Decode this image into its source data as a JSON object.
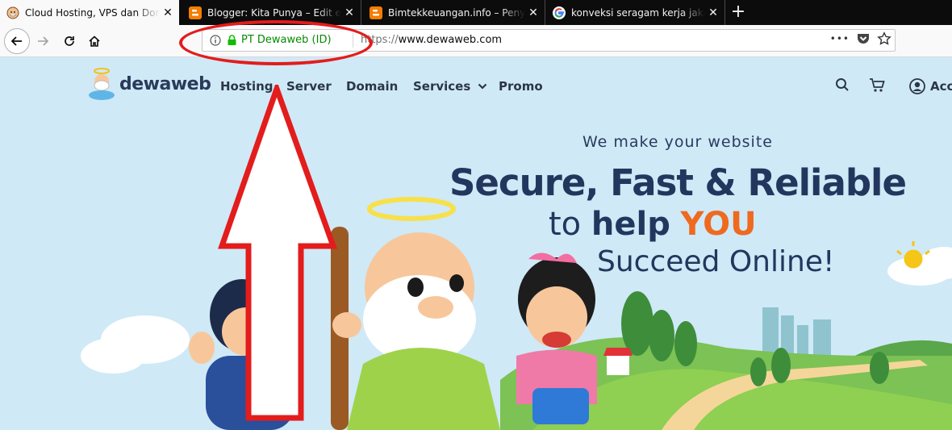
{
  "browser": {
    "tabs": [
      {
        "title": "Cloud Hosting, VPS dan Domain",
        "active": true,
        "icon": "dewaweb-favicon"
      },
      {
        "title": "Blogger: Kita Punya – Edit entri",
        "active": false,
        "icon": "blogger-icon"
      },
      {
        "title": "Bimtekkeuangan.info – Penyelenggara",
        "active": false,
        "icon": "blogger-icon"
      },
      {
        "title": "konveksi seragam kerja jakarta",
        "active": false,
        "icon": "google-icon"
      }
    ],
    "new_tab": "+",
    "close_glyph": "✕",
    "identity": "PT Dewaweb (ID)",
    "url_scheme": "https://",
    "url_host": "www.dewaweb.com",
    "page_actions": "•••"
  },
  "site": {
    "logo_text": "dewaweb",
    "menu": [
      {
        "label": "Hosting"
      },
      {
        "label": "Server"
      },
      {
        "label": "Domain"
      },
      {
        "label": "Services"
      },
      {
        "label": "Promo"
      }
    ],
    "account_label": "Acc"
  },
  "hero": {
    "tagline": "We make your website",
    "headline": "Secure, Fast & Reliable",
    "line2_a": "to",
    "line2_b": "help",
    "line2_c": "YOU",
    "line3": "Succeed Online!"
  },
  "colors": {
    "accent_orange": "#ee6a20",
    "navy": "#23375e",
    "secure_green": "#058b00",
    "annotation_red": "#e31c1c"
  }
}
